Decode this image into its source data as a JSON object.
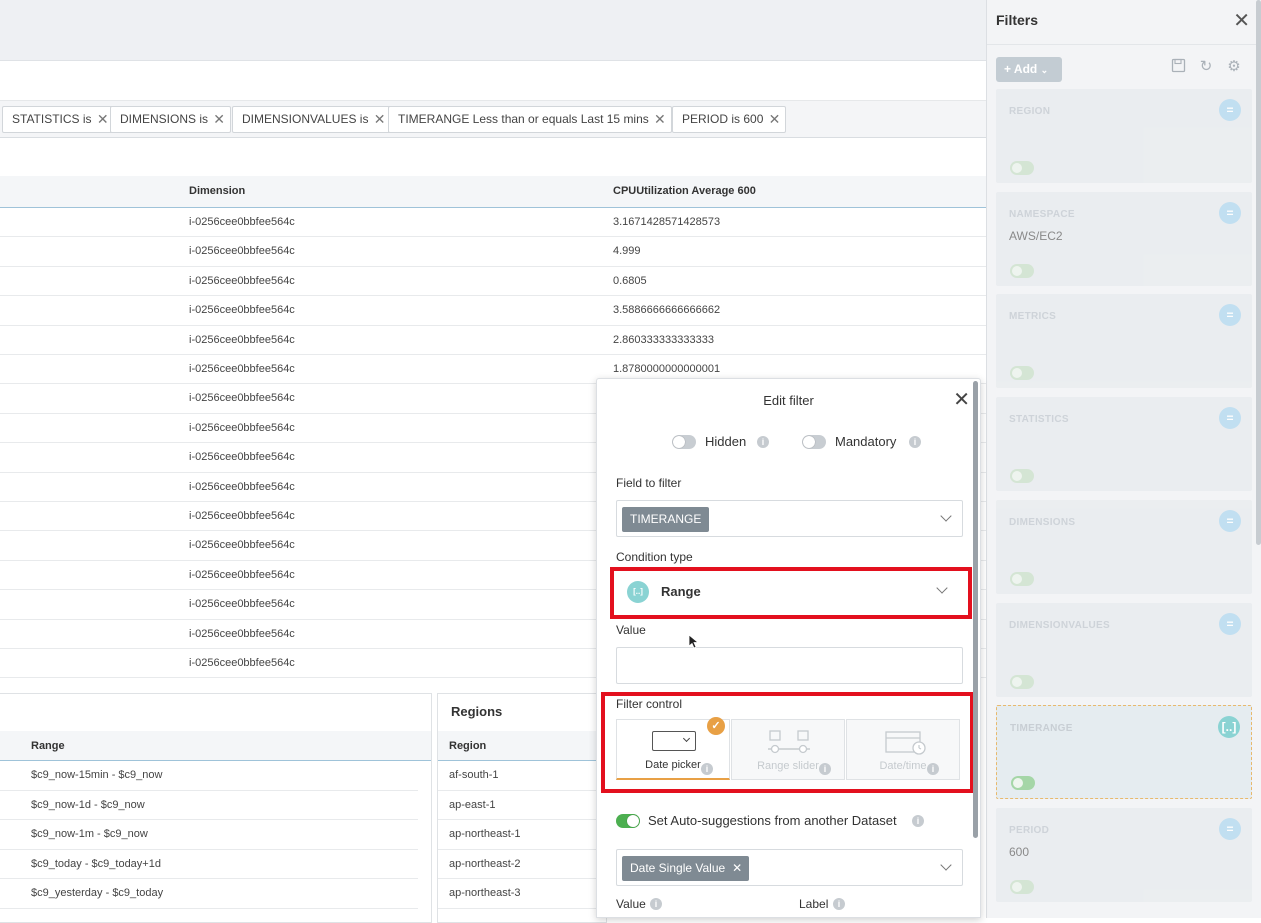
{
  "chips": [
    {
      "label": "STATISTICS is"
    },
    {
      "label": "DIMENSIONS is"
    },
    {
      "label": "DIMENSIONVALUES is"
    },
    {
      "label": "TIMERANGE Less than or equals Last 15 mins"
    },
    {
      "label": "PERIOD is 600"
    }
  ],
  "grid": {
    "headers": {
      "dimension": "Dimension",
      "cpu": "CPUUtilization Average 600"
    },
    "rows": [
      {
        "dimension": "i-0256cee0bbfee564c",
        "cpu": "3.1671428571428573"
      },
      {
        "dimension": "i-0256cee0bbfee564c",
        "cpu": "4.999"
      },
      {
        "dimension": "i-0256cee0bbfee564c",
        "cpu": "0.6805"
      },
      {
        "dimension": "i-0256cee0bbfee564c",
        "cpu": "3.5886666666666662"
      },
      {
        "dimension": "i-0256cee0bbfee564c",
        "cpu": "2.860333333333333"
      },
      {
        "dimension": "i-0256cee0bbfee564c",
        "cpu": "1.8780000000000001"
      },
      {
        "dimension": "i-0256cee0bbfee564c",
        "cpu": ""
      },
      {
        "dimension": "i-0256cee0bbfee564c",
        "cpu": ""
      },
      {
        "dimension": "i-0256cee0bbfee564c",
        "cpu": ""
      },
      {
        "dimension": "i-0256cee0bbfee564c",
        "cpu": ""
      },
      {
        "dimension": "i-0256cee0bbfee564c",
        "cpu": ""
      },
      {
        "dimension": "i-0256cee0bbfee564c",
        "cpu": ""
      },
      {
        "dimension": "i-0256cee0bbfee564c",
        "cpu": ""
      },
      {
        "dimension": "i-0256cee0bbfee564c",
        "cpu": ""
      },
      {
        "dimension": "i-0256cee0bbfee564c",
        "cpu": ""
      },
      {
        "dimension": "i-0256cee0bbfee564c",
        "cpu": ""
      }
    ]
  },
  "range_panel": {
    "header": "Range",
    "rows": [
      "$c9_now-15min - $c9_now",
      "$c9_now-1d - $c9_now",
      "$c9_now-1m - $c9_now",
      "$c9_today - $c9_today+1d",
      "$c9_yesterday - $c9_today"
    ]
  },
  "regions_panel": {
    "title": "Regions",
    "header": "Region",
    "rows": [
      "af-south-1",
      "ap-east-1",
      "ap-northeast-1",
      "ap-northeast-2",
      "ap-northeast-3"
    ]
  },
  "filters": {
    "title": "Filters",
    "add_label": "+ Add",
    "cards": [
      {
        "label": "REGION",
        "value": "",
        "badge": "="
      },
      {
        "label": "NAMESPACE",
        "value": "AWS/EC2",
        "badge": "="
      },
      {
        "label": "METRICS",
        "value": "",
        "badge": "="
      },
      {
        "label": "STATISTICS",
        "value": "",
        "badge": "="
      },
      {
        "label": "DIMENSIONS",
        "value": "",
        "badge": "="
      },
      {
        "label": "DIMENSIONVALUES",
        "value": "",
        "badge": "="
      },
      {
        "label": "TIMERANGE",
        "value": "",
        "badge": "[..]"
      },
      {
        "label": "PERIOD",
        "value": "600",
        "badge": "="
      }
    ]
  },
  "edit_filter": {
    "title": "Edit filter",
    "hidden_label": "Hidden",
    "mandatory_label": "Mandatory",
    "field_label": "Field to filter",
    "field_value": "TIMERANGE",
    "condition_label": "Condition type",
    "condition_icon": "[..]",
    "condition_value": "Range",
    "value_label": "Value",
    "value_placeholder": "",
    "filter_control_label": "Filter control",
    "controls": [
      {
        "label": "Date picker"
      },
      {
        "label": "Range slider"
      },
      {
        "label": "Date/time"
      }
    ],
    "auto_label": "Set Auto-suggestions from another Dataset",
    "dataset_tag": "Date Single Value",
    "bottom_value_label": "Value",
    "bottom_label_label": "Label"
  },
  "colors": {
    "highlight": "#e3101e",
    "accent": "#e8a045",
    "toggle_on": "#4caf50"
  }
}
